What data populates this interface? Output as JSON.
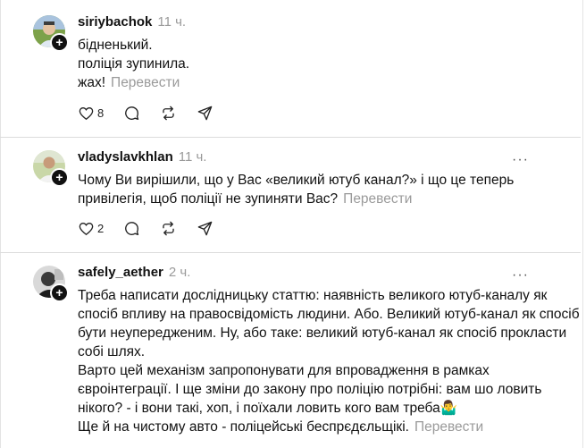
{
  "posts": [
    {
      "username": "siriybachok",
      "time": "11 ч.",
      "lines": [
        "бідненький.",
        "поліція зупинила.",
        "жах!"
      ],
      "translate": "Перевести",
      "likes": "8"
    },
    {
      "username": "vladyslavkhlan",
      "time": "11 ч.",
      "lines": [
        "Чому Ви вирішили, що у Вас «великий ютуб канал?» і що це теперь",
        "привілегія, щоб поліції не зупиняти Вас?"
      ],
      "translate": "Перевести",
      "likes": "2"
    },
    {
      "username": "safely_aether",
      "time": "2 ч.",
      "lines": [
        "Треба написати дослідницьку статтю: наявність великого ютуб-каналу як",
        "спосіб впливу на правосвідомість людини. Або. Великий ютуб-канал як спосіб",
        "бути неупередженим. Ну, або таке: великий ютуб-канал як спосіб прокласти",
        "собі шлях.",
        "Варто цей механізм запропонувати для впровадження в рамках",
        "євроінтеграції. І ще зміни до закону про поліцію потрібні: вам шо ловить",
        "нікого? - і вони такі, хоп, і поїхали ловить кого вам треба🤷‍♂️",
        "Ще й на чистому авто - поліцейські беспрєдєльщікі."
      ],
      "translate": "Перевести"
    }
  ],
  "icons": {
    "like": "heart-icon",
    "comment": "comment-bubble-icon",
    "repost": "repost-icon",
    "share": "share-send-icon",
    "more": "more-options-icon",
    "follow": "plus-follow-icon"
  }
}
